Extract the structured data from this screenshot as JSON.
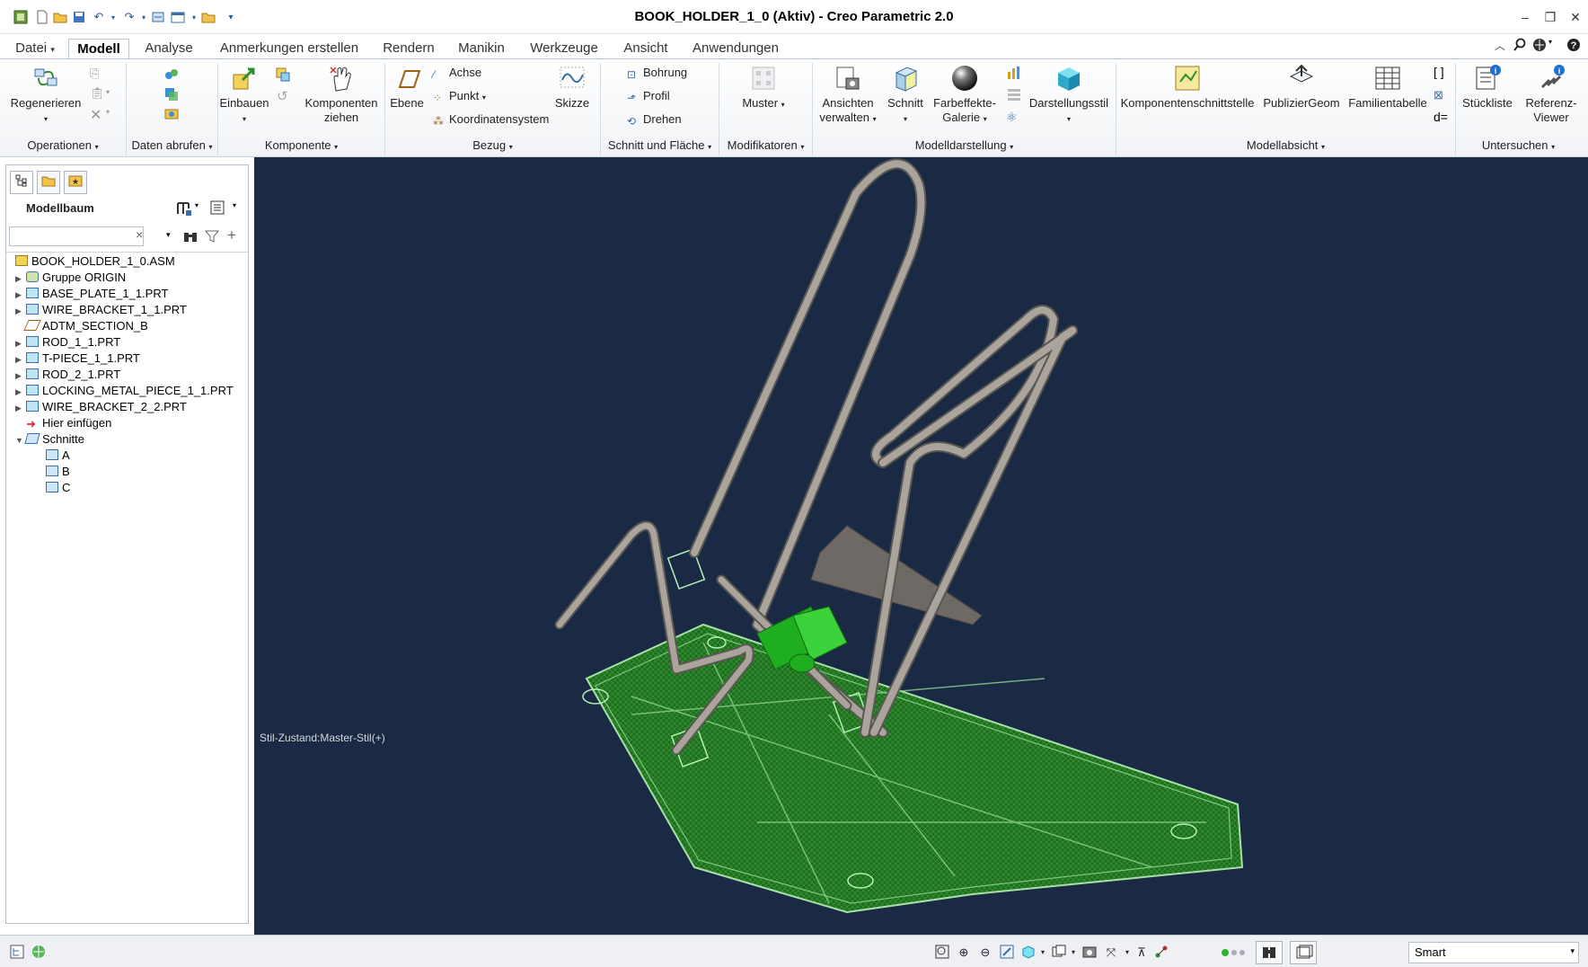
{
  "window": {
    "title": "BOOK_HOLDER_1_0 (Aktiv) - Creo Parametric 2.0",
    "controls": [
      "–",
      "❐",
      "✕"
    ]
  },
  "quick_access": [
    "app-icon",
    "new-icon",
    "open-icon",
    "save-icon",
    "undo-icon",
    "redo-icon",
    "regenerate-icon",
    "window-icon",
    "folder-icon",
    "more-icon"
  ],
  "tabs": [
    "Datei",
    "Modell",
    "Analyse",
    "Anmerkungen erstellen",
    "Rendern",
    "Manikin",
    "Werkzeuge",
    "Ansicht",
    "Anwendungen"
  ],
  "active_tab": "Modell",
  "ribbon": {
    "regenerieren": "Regenerieren",
    "einbauen": "Einbauen",
    "komponenten_ziehen_1": "Komponenten",
    "komponenten_ziehen_2": "ziehen",
    "ebene": "Ebene",
    "achse": "Achse",
    "punkt": "Punkt",
    "koordinatensystem": "Koordinatensystem",
    "skizze": "Skizze",
    "bohrung": "Bohrung",
    "profil": "Profil",
    "drehen": "Drehen",
    "muster": "Muster",
    "ansichten_1": "Ansichten",
    "ansichten_2": "verwalten",
    "schnitt": "Schnitt",
    "farbeffekte_1": "Farbeffekte-",
    "farbeffekte_2": "Galerie",
    "darstellungsstil": "Darstellungsstil",
    "komponentenschnittstelle": "Komponentenschnittstelle",
    "publiziergeom": "PublizierGeom",
    "familientabelle": "Familientabelle",
    "stueckliste": "Stückliste",
    "referenz_1": "Referenz-",
    "referenz_2": "Viewer",
    "d_eq": "d="
  },
  "groups": [
    "Operationen",
    "Daten abrufen",
    "Komponente",
    "Bezug",
    "Schnitt und Fläche",
    "Modifikatoren",
    "Modelldarstellung",
    "Modellabsicht",
    "Untersuchen"
  ],
  "panel": {
    "title": "Modellbaum",
    "search_placeholder": "",
    "clear": "×"
  },
  "tree": [
    {
      "label": "BOOK_HOLDER_1_0.ASM",
      "expander": "",
      "icon": "assembly"
    },
    {
      "label": "Gruppe ORIGIN",
      "expander": "▶",
      "icon": "group"
    },
    {
      "label": "BASE_PLATE_1_1.PRT",
      "expander": "▶",
      "icon": "part"
    },
    {
      "label": "WIRE_BRACKET_1_1.PRT",
      "expander": "▶",
      "icon": "part"
    },
    {
      "label": "ADTM_SECTION_B",
      "expander": "",
      "icon": "datum"
    },
    {
      "label": "ROD_1_1.PRT",
      "expander": "▶",
      "icon": "part"
    },
    {
      "label": "T-PIECE_1_1.PRT",
      "expander": "▶",
      "icon": "part"
    },
    {
      "label": "ROD_2_1.PRT",
      "expander": "▶",
      "icon": "part"
    },
    {
      "label": "LOCKING_METAL_PIECE_1_1.PRT",
      "expander": "▶",
      "icon": "part"
    },
    {
      "label": "WIRE_BRACKET_2_2.PRT",
      "expander": "▶",
      "icon": "part"
    },
    {
      "label": "Hier einfügen",
      "expander": "",
      "icon": "insert"
    },
    {
      "label": "Schnitte",
      "expander": "▼",
      "icon": "folder"
    },
    {
      "label": "A",
      "expander": "",
      "icon": "section"
    },
    {
      "label": "B",
      "expander": "",
      "icon": "section"
    },
    {
      "label": "C",
      "expander": "",
      "icon": "section"
    }
  ],
  "viewport": {
    "style_state": "Stil-Zustand:Master-Stil(+)",
    "background": "#1b2a44"
  },
  "status": {
    "filter_value": "Smart"
  },
  "colors": {
    "plate": "#1f7a1f",
    "wire": "#9a958f",
    "t_piece": "#22c322"
  }
}
